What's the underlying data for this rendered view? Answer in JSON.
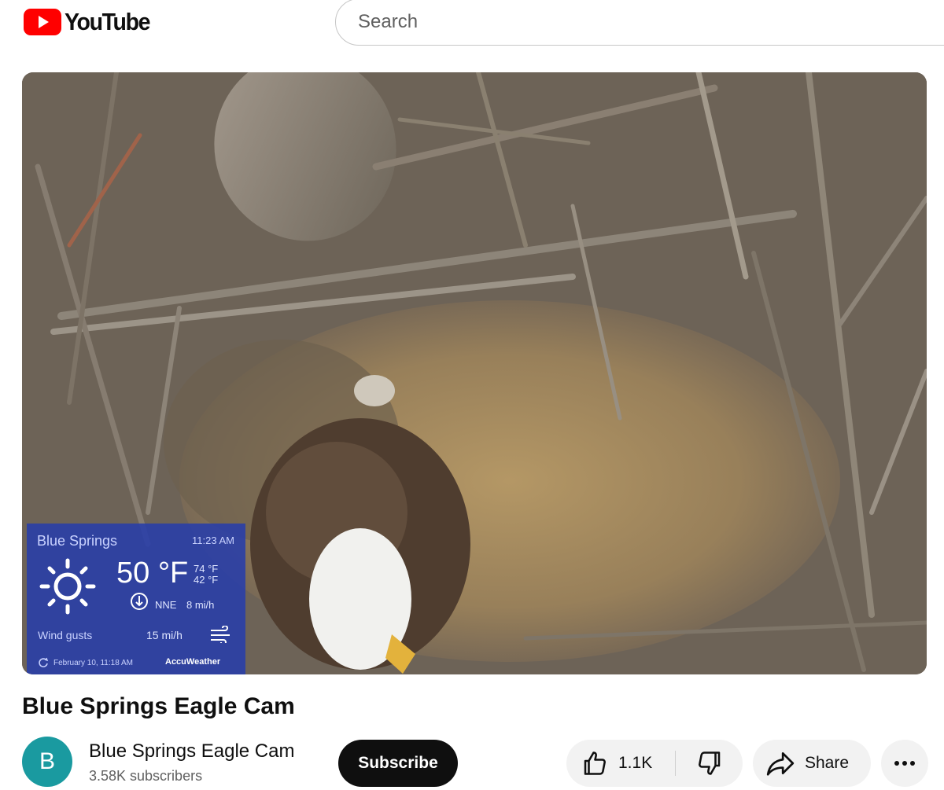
{
  "header": {
    "logo_text": "YouTube",
    "logo_color": "#ff0000",
    "search_placeholder": "Search"
  },
  "video": {
    "title": "Blue Springs Eagle Cam",
    "weather_overlay": {
      "location": "Blue Springs",
      "time": "11:23 AM",
      "temperature": "50 °F",
      "high": "74 °F",
      "low": "42 °F",
      "wind_direction": "NNE",
      "wind_speed": "8 mi/h",
      "gusts_label": "Wind gusts",
      "gusts_value": "15 mi/h",
      "updated": "February 10, 11:18 AM",
      "brand": "AccuWeather",
      "icon": "sun-icon"
    }
  },
  "channel": {
    "avatar_letter": "B",
    "avatar_color": "#1a9aa0",
    "name": "Blue Springs Eagle Cam",
    "subscribers": "3.58K subscribers",
    "subscribe_label": "Subscribe"
  },
  "actions": {
    "like_count": "1.1K",
    "share_label": "Share",
    "icons": [
      "thumbs-up-icon",
      "thumbs-down-icon",
      "share-icon",
      "more-icon"
    ]
  }
}
